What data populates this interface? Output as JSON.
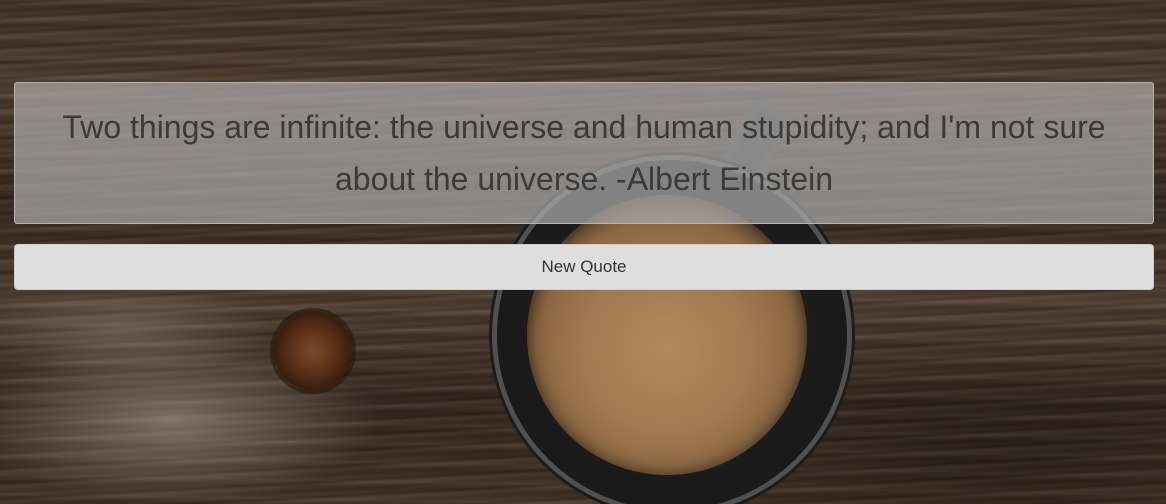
{
  "quote": {
    "text": "Two things are infinite: the universe and human stupidity; and I'm not sure about the universe. -Albert Einstein"
  },
  "actions": {
    "new_quote_label": "New Quote"
  },
  "theme": {
    "panel_color": "#aaaaaa",
    "button_color": "#dedede",
    "text_color": "#3a3a3a"
  }
}
